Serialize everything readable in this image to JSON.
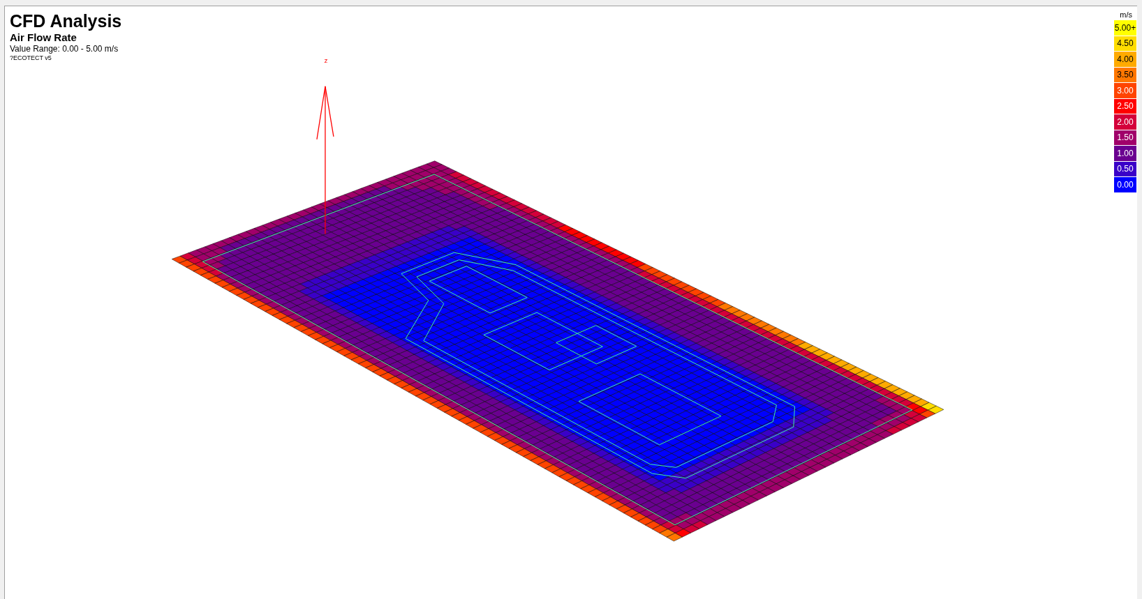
{
  "title": "CFD Analysis",
  "subtitle": "Air Flow Rate",
  "value_range": "Value Range: 0.00 - 5.00 m/s",
  "credit": "?ECOTECT v5",
  "axis_label": "z",
  "legend": {
    "unit": "m/s",
    "items": [
      {
        "label": "5.00+",
        "color": "#ffff00"
      },
      {
        "label": "4.50",
        "color": "#ffdd00"
      },
      {
        "label": "4.00",
        "color": "#ffaa00"
      },
      {
        "label": "3.50",
        "color": "#ff7700"
      },
      {
        "label": "3.00",
        "color": "#ff4400"
      },
      {
        "label": "2.50",
        "color": "#ff0000"
      },
      {
        "label": "2.00",
        "color": "#d4003a"
      },
      {
        "label": "1.50",
        "color": "#a0006a"
      },
      {
        "label": "1.00",
        "color": "#6a0090"
      },
      {
        "label": "0.50",
        "color": "#3a00c8"
      },
      {
        "label": "0.00",
        "color": "#0000ff"
      }
    ]
  }
}
